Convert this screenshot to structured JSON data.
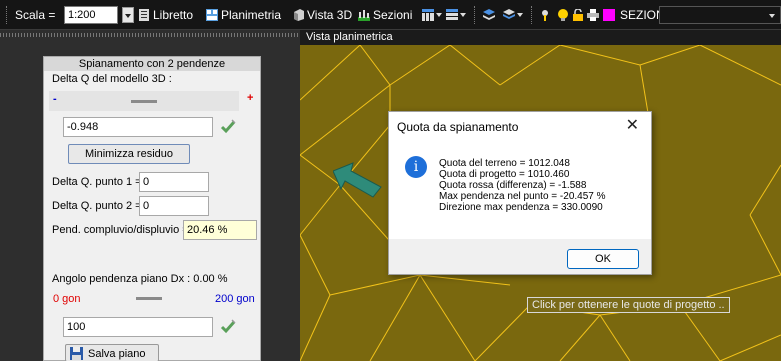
{
  "toolbar": {
    "scale_label": "Scala =",
    "scale_value": "1:200",
    "libretto_label": "Libretto",
    "planimetria_label": "Planimetria",
    "vista3d_label": "Vista 3D",
    "sezioni_btn_label": "Sezioni",
    "sezioni_select_value": "SEZIONI",
    "icons": [
      "grip",
      "book-icon",
      "plan-icon",
      "cube-icon",
      "sections-icon",
      "layers-icon",
      "stack-icon",
      "pin-icon",
      "lightbulb-icon",
      "lock-icon",
      "printer-icon",
      "magenta-color-icon"
    ]
  },
  "panel": {
    "title": "Spianamento con 2 pendenze",
    "delta_q_label": "Delta Q del modello 3D :",
    "minus_label": "-",
    "plus_label": "+",
    "delta_q_value": "-0.948",
    "minimize_button": "Minimizza residuo",
    "delta_q_p1_label": "Delta Q. punto 1 =",
    "delta_q_p1_value": "0",
    "delta_q_p2_label": "Delta Q. punto 2 =",
    "delta_q_p2_value": "0",
    "pend_label": "Pend. compluvio/displuvio =",
    "pend_value": "20.46 %",
    "angolo_label": "Angolo pendenza piano Dx :  0.00 %",
    "gon_min": "0 gon",
    "gon_max": "200 gon",
    "angle_value": "100",
    "save_button": "Salva piano Dx"
  },
  "map": {
    "title": "Vista planimetrica",
    "tooltip": "Click per ottenere le quote di progetto ..",
    "bg_color": "#7a680e",
    "line_color": "#f2c21a",
    "arrow_color": "#2e8b7a"
  },
  "dialog": {
    "title": "Quota da spianamento",
    "close_symbol": "✕",
    "info_symbol": "i",
    "lines": [
      "Quota del terreno = 1012.048",
      "Quota di progetto = 1010.460",
      "Quota rossa (differenza) = -1.588",
      "Max pendenza nel punto = -20.457 %",
      "Direzione max pendenza = 330.0090"
    ],
    "ok_label": "OK"
  }
}
